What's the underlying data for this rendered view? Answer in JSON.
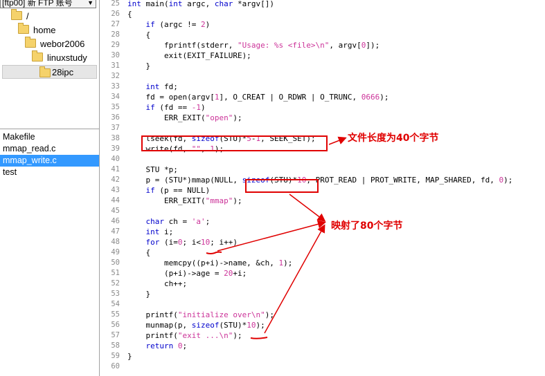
{
  "account": {
    "label": "[ftp00] 新 FTP 账号"
  },
  "tree": [
    {
      "label": "/",
      "depth": 0
    },
    {
      "label": "home",
      "depth": 1
    },
    {
      "label": "webor2006",
      "depth": 2
    },
    {
      "label": "linuxstudy",
      "depth": 3
    },
    {
      "label": "28ipc",
      "depth": 4,
      "selected": true
    }
  ],
  "files": [
    {
      "name": "Makefile"
    },
    {
      "name": "mmap_read.c"
    },
    {
      "name": "mmap_write.c",
      "selected": true
    },
    {
      "name": "test"
    }
  ],
  "code": [
    {
      "n": "25",
      "t": [
        [
          "int",
          "kw"
        ],
        [
          " main("
        ],
        [
          "int",
          "kw"
        ],
        [
          " argc, "
        ],
        [
          "char",
          "kw"
        ],
        [
          " *argv[])"
        ]
      ]
    },
    {
      "n": "26",
      "t": [
        [
          "{"
        ]
      ]
    },
    {
      "n": "27",
      "t": [
        [
          "    "
        ],
        [
          "if",
          "kw"
        ],
        [
          " (argc != "
        ],
        [
          "2",
          "nu"
        ],
        [
          ")"
        ]
      ]
    },
    {
      "n": "28",
      "t": [
        [
          "    {"
        ]
      ]
    },
    {
      "n": "29",
      "t": [
        [
          "        fprintf(stderr, "
        ],
        [
          "\"Usage: %s <file>\\n\"",
          "st"
        ],
        [
          ", argv["
        ],
        [
          "0",
          "nu"
        ],
        [
          "]);"
        ]
      ]
    },
    {
      "n": "30",
      "t": [
        [
          "        exit(EXIT_FAILURE);"
        ]
      ]
    },
    {
      "n": "31",
      "t": [
        [
          "    }"
        ]
      ]
    },
    {
      "n": "32",
      "t": [
        [
          ""
        ]
      ]
    },
    {
      "n": "33",
      "t": [
        [
          "    "
        ],
        [
          "int",
          "kw"
        ],
        [
          " fd;"
        ]
      ]
    },
    {
      "n": "34",
      "t": [
        [
          "    fd = open(argv["
        ],
        [
          "1",
          "nu"
        ],
        [
          "], O_CREAT | O_RDWR | O_TRUNC, "
        ],
        [
          "0666",
          "nu"
        ],
        [
          ");"
        ]
      ]
    },
    {
      "n": "35",
      "t": [
        [
          "    "
        ],
        [
          "if",
          "kw"
        ],
        [
          " (fd == "
        ],
        [
          "-1",
          "nu"
        ],
        [
          ")"
        ]
      ]
    },
    {
      "n": "36",
      "t": [
        [
          "        ERR_EXIT("
        ],
        [
          "\"open\"",
          "st"
        ],
        [
          ");"
        ]
      ]
    },
    {
      "n": "37",
      "t": [
        [
          ""
        ]
      ]
    },
    {
      "n": "38",
      "t": [
        [
          "    lseek(fd, "
        ],
        [
          "sizeof",
          "kw"
        ],
        [
          "(STU)*"
        ],
        [
          "5",
          "nu"
        ],
        [
          "-"
        ],
        [
          "1",
          "nu"
        ],
        [
          ", SEEK_SET);"
        ]
      ]
    },
    {
      "n": "39",
      "t": [
        [
          "    write(fd, "
        ],
        [
          "\"\"",
          "st"
        ],
        [
          ", "
        ],
        [
          "1",
          "nu"
        ],
        [
          ");"
        ]
      ]
    },
    {
      "n": "40",
      "t": [
        [
          ""
        ]
      ]
    },
    {
      "n": "41",
      "t": [
        [
          "    STU *p;"
        ]
      ]
    },
    {
      "n": "42",
      "t": [
        [
          "    p = (STU*)mmap(NULL, "
        ],
        [
          "sizeof",
          "kw"
        ],
        [
          "(STU)*"
        ],
        [
          "10",
          "nu"
        ],
        [
          ", PROT_READ | PROT_WRITE, MAP_SHARED, fd, "
        ],
        [
          "0",
          "nu"
        ],
        [
          ");"
        ]
      ]
    },
    {
      "n": "43",
      "t": [
        [
          "    "
        ],
        [
          "if",
          "kw"
        ],
        [
          " (p == NULL)"
        ]
      ]
    },
    {
      "n": "44",
      "t": [
        [
          "        ERR_EXIT("
        ],
        [
          "\"mmap\"",
          "st"
        ],
        [
          ");"
        ]
      ]
    },
    {
      "n": "45",
      "t": [
        [
          ""
        ]
      ]
    },
    {
      "n": "46",
      "t": [
        [
          "    "
        ],
        [
          "char",
          "kw"
        ],
        [
          " ch = "
        ],
        [
          "'a'",
          "st"
        ],
        [
          ";"
        ]
      ]
    },
    {
      "n": "47",
      "t": [
        [
          "    "
        ],
        [
          "int",
          "kw"
        ],
        [
          " i;"
        ]
      ]
    },
    {
      "n": "48",
      "t": [
        [
          "    "
        ],
        [
          "for",
          "kw"
        ],
        [
          " (i="
        ],
        [
          "0",
          "nu"
        ],
        [
          "; i<"
        ],
        [
          "10",
          "nu"
        ],
        [
          "; i++)"
        ]
      ]
    },
    {
      "n": "49",
      "t": [
        [
          "    {"
        ]
      ]
    },
    {
      "n": "50",
      "t": [
        [
          "        memcpy((p+i)->name, &ch, "
        ],
        [
          "1",
          "nu"
        ],
        [
          ");"
        ]
      ]
    },
    {
      "n": "51",
      "t": [
        [
          "        (p+i)->age = "
        ],
        [
          "20",
          "nu"
        ],
        [
          "+i;"
        ]
      ]
    },
    {
      "n": "52",
      "t": [
        [
          "        ch++;"
        ]
      ]
    },
    {
      "n": "53",
      "t": [
        [
          "    }"
        ]
      ]
    },
    {
      "n": "54",
      "t": [
        [
          ""
        ]
      ]
    },
    {
      "n": "55",
      "t": [
        [
          "    printf("
        ],
        [
          "\"initialize over\\n\"",
          "st"
        ],
        [
          ");"
        ]
      ]
    },
    {
      "n": "56",
      "t": [
        [
          "    munmap(p, "
        ],
        [
          "sizeof",
          "kw"
        ],
        [
          "(STU)*"
        ],
        [
          "10",
          "nu"
        ],
        [
          ");"
        ]
      ]
    },
    {
      "n": "57",
      "t": [
        [
          "    printf("
        ],
        [
          "\"exit ...\\n\"",
          "st"
        ],
        [
          ");"
        ]
      ]
    },
    {
      "n": "58",
      "t": [
        [
          "    "
        ],
        [
          "return",
          "kw"
        ],
        [
          " "
        ],
        [
          "0",
          "nu"
        ],
        [
          ";"
        ]
      ]
    },
    {
      "n": "59",
      "t": [
        [
          "}"
        ]
      ]
    },
    {
      "n": "60",
      "t": [
        [
          ""
        ]
      ]
    }
  ],
  "annotations": {
    "note1": "文件长度为40个字节",
    "note2": "映射了80个字节"
  },
  "colors": {
    "keyword": "#0000cc",
    "string": "#cc3399",
    "annotation": "#e00000",
    "selection": "#3399ff"
  }
}
